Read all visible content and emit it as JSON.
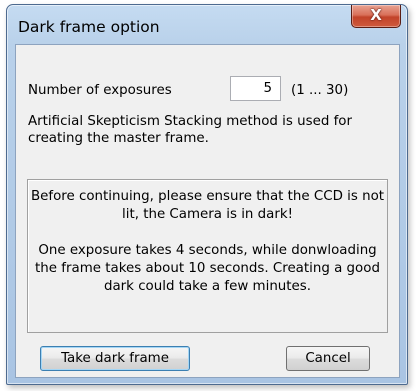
{
  "window": {
    "title": "Dark frame option",
    "close_symbol": "X"
  },
  "exposures": {
    "label": "Number of exposures",
    "value": "5",
    "range": "(1 ... 30)"
  },
  "method_text": "Artificial Skepticism Stacking method is used for creating the master frame.",
  "info": {
    "warning": "Before continuing, please ensure that the CCD is not lit, the Camera is in dark!",
    "timing": "One exposure takes 4 seconds, while donwloading the frame takes about 10 seconds. Creating a good dark could take a few minutes."
  },
  "buttons": {
    "take_dark_frame": "Take dark frame",
    "cancel": "Cancel"
  },
  "colors": {
    "close_button": "#c2432a",
    "client_background": "#f0f0f0",
    "frame_accent": "#b9d1ea"
  }
}
